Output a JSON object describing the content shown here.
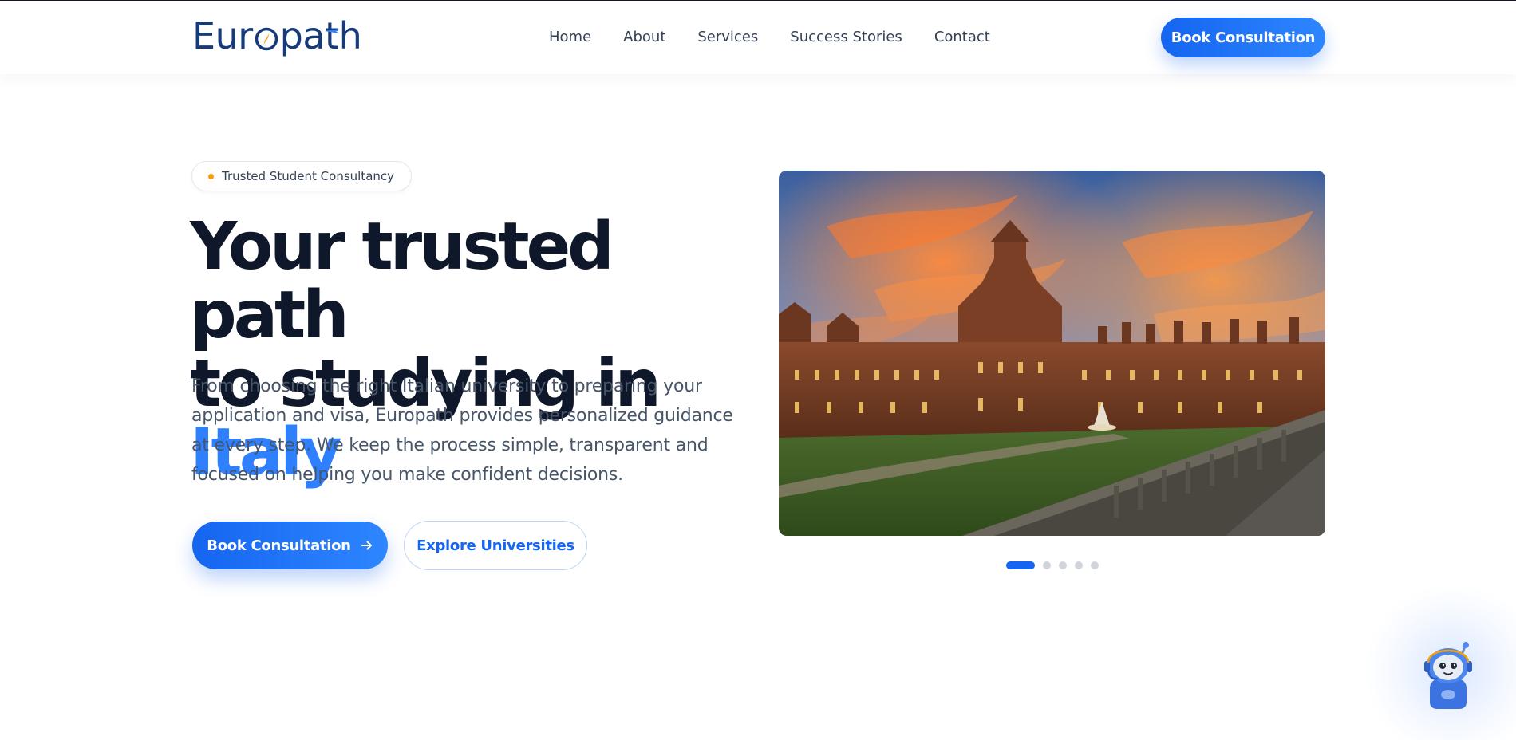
{
  "brand": {
    "name_part1": "Eur",
    "name_part2": "path",
    "primary_color": "#1565f0",
    "accent_color": "#2e80ff",
    "dark_color": "#0f172a"
  },
  "nav": {
    "items": [
      {
        "label": "Home"
      },
      {
        "label": "About"
      },
      {
        "label": "Services"
      },
      {
        "label": "Success Stories"
      },
      {
        "label": "Contact"
      }
    ],
    "cta_label": "Book Consultation"
  },
  "hero": {
    "badge_text": "Trusted Student Consultancy",
    "headline_line1": "Your trusted path",
    "headline_line2_prefix": "to studying in ",
    "headline_accent": "Italy",
    "lead": "From choosing the right Italian university to preparing your application and visa, Europath provides personalized guidance at every step. We keep the process simple, transparent and focused on helping you make confident decisions.",
    "primary_button": "Book Consultation",
    "secondary_button": "Explore Universities"
  },
  "carousel": {
    "slide_count": 5,
    "active_index": 0
  },
  "icons": {
    "logo": "compass-icon",
    "primary_button": "arrow-right-icon",
    "chat": "robot-assistant-icon"
  }
}
